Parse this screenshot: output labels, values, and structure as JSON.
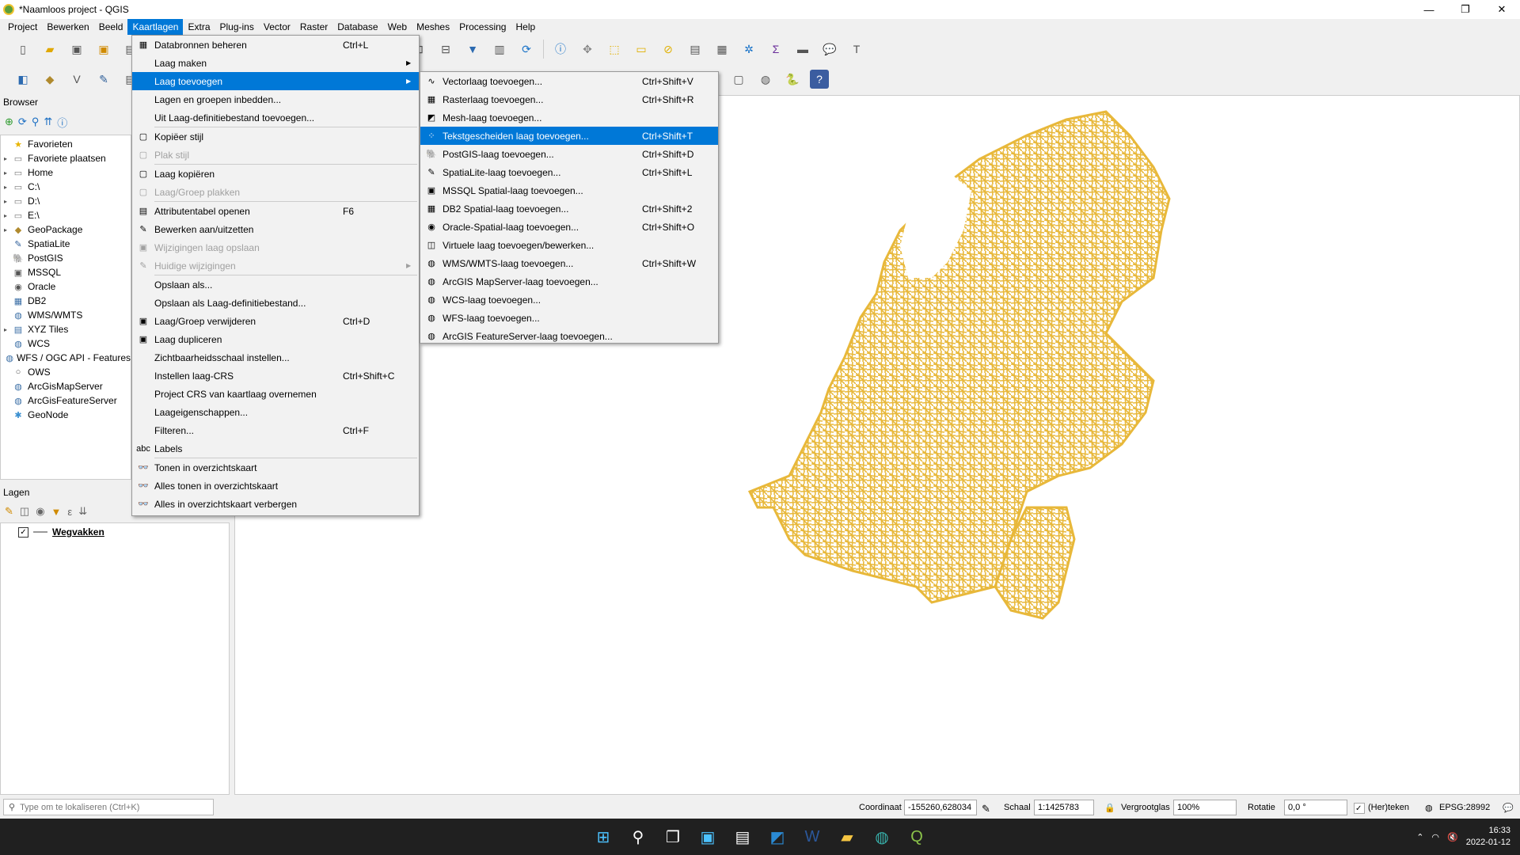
{
  "window": {
    "title": "*Naamloos project - QGIS",
    "controls": [
      "—",
      "❐",
      "✕"
    ]
  },
  "menubar": {
    "items": [
      "Project",
      "Bewerken",
      "Beeld",
      "Kaartlagen",
      "Extra",
      "Plug-ins",
      "Vector",
      "Raster",
      "Database",
      "Web",
      "Meshes",
      "Processing",
      "Help"
    ],
    "active": "Kaartlagen"
  },
  "browser": {
    "title": "Browser",
    "items": [
      {
        "label": "Favorieten",
        "icon": "star-icon",
        "arrow": "",
        "glyph": "★",
        "color": "#e8b400"
      },
      {
        "label": "Favoriete plaatsen",
        "icon": "folder-icon",
        "arrow": "▸",
        "glyph": "▭",
        "color": "#777"
      },
      {
        "label": "Home",
        "icon": "folder-icon",
        "arrow": "▸",
        "glyph": "▭",
        "color": "#777"
      },
      {
        "label": "C:\\",
        "icon": "folder-icon",
        "arrow": "▸",
        "glyph": "▭",
        "color": "#777"
      },
      {
        "label": "D:\\",
        "icon": "folder-icon",
        "arrow": "▸",
        "glyph": "▭",
        "color": "#777"
      },
      {
        "label": "E:\\",
        "icon": "folder-icon",
        "arrow": "▸",
        "glyph": "▭",
        "color": "#777"
      },
      {
        "label": "GeoPackage",
        "icon": "geopackage-icon",
        "arrow": "▸",
        "glyph": "◆",
        "color": "#b08a2e"
      },
      {
        "label": "SpatiaLite",
        "icon": "spatialite-icon",
        "arrow": "",
        "glyph": "✎",
        "color": "#2f5f9a"
      },
      {
        "label": "PostGIS",
        "icon": "postgis-icon",
        "arrow": "",
        "glyph": "🐘",
        "color": "#336791"
      },
      {
        "label": "MSSQL",
        "icon": "mssql-icon",
        "arrow": "",
        "glyph": "▣",
        "color": "#555"
      },
      {
        "label": "Oracle",
        "icon": "oracle-icon",
        "arrow": "",
        "glyph": "◉",
        "color": "#555"
      },
      {
        "label": "DB2",
        "icon": "db2-icon",
        "arrow": "",
        "glyph": "▦",
        "color": "#3a6ea5"
      },
      {
        "label": "WMS/WMTS",
        "icon": "globe-icon",
        "arrow": "",
        "glyph": "◍",
        "color": "#3a6ea5"
      },
      {
        "label": "XYZ Tiles",
        "icon": "xyz-tiles-icon",
        "arrow": "▸",
        "glyph": "▤",
        "color": "#3a6ea5"
      },
      {
        "label": "WCS",
        "icon": "globe-icon",
        "arrow": "",
        "glyph": "◍",
        "color": "#3a6ea5"
      },
      {
        "label": "WFS / OGC API - Features",
        "icon": "globe-icon",
        "arrow": "",
        "glyph": "◍",
        "color": "#3a6ea5"
      },
      {
        "label": "OWS",
        "icon": "ows-icon",
        "arrow": "",
        "glyph": "○",
        "color": "#555"
      },
      {
        "label": "ArcGisMapServer",
        "icon": "globe-icon",
        "arrow": "",
        "glyph": "◍",
        "color": "#3a6ea5"
      },
      {
        "label": "ArcGisFeatureServer",
        "icon": "globe-icon",
        "arrow": "",
        "glyph": "◍",
        "color": "#3a6ea5"
      },
      {
        "label": "GeoNode",
        "icon": "geonode-icon",
        "arrow": "",
        "glyph": "✱",
        "color": "#3a8fd0"
      }
    ]
  },
  "layers": {
    "title": "Lagen",
    "layer_name": "Wegvakken",
    "checked": "✓"
  },
  "menu_main": {
    "items": [
      {
        "label": "Databronnen beheren",
        "shortcut": "Ctrl+L",
        "icon": "datasource-icon",
        "glyph": "▦",
        "state": ""
      },
      {
        "label": "Laag maken",
        "shortcut": "",
        "icon": "",
        "glyph": "",
        "state": "",
        "submenu": true
      },
      {
        "label": "Laag toevoegen",
        "shortcut": "",
        "icon": "",
        "glyph": "",
        "state": "hl",
        "submenu": true
      },
      {
        "label": "Lagen en groepen inbedden...",
        "shortcut": "",
        "icon": "",
        "glyph": "",
        "state": ""
      },
      {
        "label": "Uit Laag-definitiebestand toevoegen...",
        "shortcut": "",
        "icon": "",
        "glyph": "",
        "state": ""
      },
      {
        "sep": true
      },
      {
        "label": "Kopiëer stijl",
        "shortcut": "",
        "icon": "copy-style-icon",
        "glyph": "▢",
        "state": ""
      },
      {
        "label": "Plak stijl",
        "shortcut": "",
        "icon": "paste-style-icon",
        "glyph": "▢",
        "state": "dis"
      },
      {
        "sep": true
      },
      {
        "label": "Laag kopiëren",
        "shortcut": "",
        "icon": "copy-layer-icon",
        "glyph": "▢",
        "state": ""
      },
      {
        "label": "Laag/Groep plakken",
        "shortcut": "",
        "icon": "paste-layer-icon",
        "glyph": "▢",
        "state": "dis"
      },
      {
        "sep": true
      },
      {
        "label": "Attributentabel openen",
        "shortcut": "F6",
        "icon": "table-icon",
        "glyph": "▤",
        "state": ""
      },
      {
        "label": "Bewerken aan/uitzetten",
        "shortcut": "",
        "icon": "pencil-icon",
        "glyph": "✎",
        "state": ""
      },
      {
        "label": "Wijzigingen laag opslaan",
        "shortcut": "",
        "icon": "save-edits-icon",
        "glyph": "▣",
        "state": "dis"
      },
      {
        "label": "Huidige wijzigingen",
        "shortcut": "",
        "icon": "current-edits-icon",
        "glyph": "✎",
        "state": "dis",
        "submenu": true
      },
      {
        "sep": true
      },
      {
        "label": "Opslaan als...",
        "shortcut": "",
        "icon": "",
        "glyph": "",
        "state": ""
      },
      {
        "label": "Opslaan als Laag-definitiebestand...",
        "shortcut": "",
        "icon": "",
        "glyph": "",
        "state": ""
      },
      {
        "label": "Laag/Groep verwijderen",
        "shortcut": "Ctrl+D",
        "icon": "remove-layer-icon",
        "glyph": "▣",
        "state": ""
      },
      {
        "label": "Laag dupliceren",
        "shortcut": "",
        "icon": "duplicate-layer-icon",
        "glyph": "▣",
        "state": ""
      },
      {
        "label": "Zichtbaarheidsschaal instellen...",
        "shortcut": "",
        "icon": "",
        "glyph": "",
        "state": ""
      },
      {
        "label": "Instellen laag-CRS",
        "shortcut": "Ctrl+Shift+C",
        "icon": "",
        "glyph": "",
        "state": ""
      },
      {
        "label": "Project CRS van kaartlaag overnemen",
        "shortcut": "",
        "icon": "",
        "glyph": "",
        "state": ""
      },
      {
        "label": "Laageigenschappen...",
        "shortcut": "",
        "icon": "",
        "glyph": "",
        "state": ""
      },
      {
        "label": "Filteren...",
        "shortcut": "Ctrl+F",
        "icon": "",
        "glyph": "",
        "state": ""
      },
      {
        "label": "Labels",
        "shortcut": "",
        "icon": "labels-icon",
        "glyph": "abc",
        "state": ""
      },
      {
        "sep": true
      },
      {
        "label": "Tonen in overzichtskaart",
        "shortcut": "",
        "icon": "overview-icon",
        "glyph": "👓",
        "state": ""
      },
      {
        "label": "Alles tonen in overzichtskaart",
        "shortcut": "",
        "icon": "overview-icon",
        "glyph": "👓",
        "state": ""
      },
      {
        "label": "Alles in overzichtskaart verbergen",
        "shortcut": "",
        "icon": "overview-hide-icon",
        "glyph": "👓",
        "state": ""
      }
    ]
  },
  "menu_sub": {
    "items": [
      {
        "label": "Vectorlaag toevoegen...",
        "shortcut": "Ctrl+Shift+V",
        "icon": "vector-layer-icon",
        "glyph": "∿",
        "state": ""
      },
      {
        "label": "Rasterlaag toevoegen...",
        "shortcut": "Ctrl+Shift+R",
        "icon": "raster-layer-icon",
        "glyph": "▦",
        "state": ""
      },
      {
        "label": "Mesh-laag toevoegen...",
        "shortcut": "",
        "icon": "mesh-layer-icon",
        "glyph": "◩",
        "state": ""
      },
      {
        "label": "Tekstgescheiden laag toevoegen...",
        "shortcut": "Ctrl+Shift+T",
        "icon": "delimited-text-icon",
        "glyph": "⁘",
        "state": "hl"
      },
      {
        "label": "PostGIS-laag toevoegen...",
        "shortcut": "Ctrl+Shift+D",
        "icon": "postgis-icon",
        "glyph": "🐘",
        "state": ""
      },
      {
        "label": "SpatiaLite-laag toevoegen...",
        "shortcut": "Ctrl+Shift+L",
        "icon": "spatialite-icon",
        "glyph": "✎",
        "state": ""
      },
      {
        "label": "MSSQL Spatial-laag toevoegen...",
        "shortcut": "",
        "icon": "mssql-icon",
        "glyph": "▣",
        "state": ""
      },
      {
        "label": "DB2 Spatial-laag toevoegen...",
        "shortcut": "Ctrl+Shift+2",
        "icon": "db2-icon",
        "glyph": "▦",
        "state": ""
      },
      {
        "label": "Oracle-Spatial-laag toevoegen...",
        "shortcut": "Ctrl+Shift+O",
        "icon": "oracle-icon",
        "glyph": "◉",
        "state": ""
      },
      {
        "label": "Virtuele laag toevoegen/bewerken...",
        "shortcut": "",
        "icon": "virtual-layer-icon",
        "glyph": "◫",
        "state": ""
      },
      {
        "label": "WMS/WMTS-laag toevoegen...",
        "shortcut": "Ctrl+Shift+W",
        "icon": "globe-icon",
        "glyph": "◍",
        "state": ""
      },
      {
        "label": "ArcGIS MapServer-laag toevoegen...",
        "shortcut": "",
        "icon": "globe-icon",
        "glyph": "◍",
        "state": ""
      },
      {
        "label": "WCS-laag toevoegen...",
        "shortcut": "",
        "icon": "globe-icon",
        "glyph": "◍",
        "state": ""
      },
      {
        "label": "WFS-laag toevoegen...",
        "shortcut": "",
        "icon": "globe-icon",
        "glyph": "◍",
        "state": ""
      },
      {
        "label": "ArcGIS FeatureServer-laag toevoegen...",
        "shortcut": "",
        "icon": "globe-icon",
        "glyph": "◍",
        "state": ""
      }
    ]
  },
  "statusbar": {
    "locator_placeholder": "Type om te lokaliseren (Ctrl+K)",
    "coord_label": "Coordinaat",
    "coord_value": "-155260,628034",
    "scale_label": "Schaal",
    "scale_value": "1:1425783",
    "magnifier_label": "Vergrootglas",
    "magnifier_value": "100%",
    "rotation_label": "Rotatie",
    "rotation_value": "0,0 °",
    "render_label": "(Her)teken",
    "render_checked": "✓",
    "crs_label": "EPSG:28992"
  },
  "taskbar": {
    "time": "16:33",
    "date": "2022-01-12"
  },
  "colors": {
    "map_fill": "#e8b83a",
    "accent": "#0078d7"
  }
}
